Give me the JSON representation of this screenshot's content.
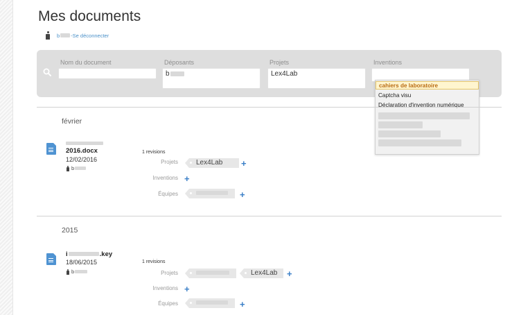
{
  "page": {
    "title": "Mes documents"
  },
  "user": {
    "name": "b",
    "separator": " - ",
    "logout_label": "Se déconnecter"
  },
  "filters": {
    "document_name_label": "Nom du document",
    "depositors_label": "Déposants",
    "depositors_value": "b",
    "projects_label": "Projets",
    "projects_value": "Lex4Lab",
    "inventions_label": "Inventions"
  },
  "dropdown": {
    "options": [
      "cahiers de laboratoire",
      "Captcha visu",
      "Déclaration d'invention numérique"
    ]
  },
  "groups": [
    {
      "title": "février",
      "doc": {
        "name": "2016.docx",
        "date": "12/02/2016",
        "user": "b",
        "revisions": "1 revisions",
        "projects_label": "Projets",
        "projects": [
          "Lex4Lab"
        ],
        "inventions_label": "Inventions",
        "teams_label": "Équipes"
      }
    },
    {
      "title": "2015",
      "doc": {
        "name_prefix": "i",
        "name": ".key",
        "date": "18/06/2015",
        "user": "b",
        "revisions": "1 revisions",
        "projects_label": "Projets",
        "projects": [
          "Lex4Lab"
        ],
        "inventions_label": "Inventions",
        "teams_label": "Équipes"
      }
    }
  ],
  "icons": {
    "search": "search-icon",
    "document": "document-icon",
    "user": "user-icon",
    "add": "plus-icon"
  },
  "colors": {
    "link": "#4a90c8",
    "add": "#3a7fc7",
    "highlight": "#b86b10",
    "doc_icon": "#4f93d2"
  }
}
